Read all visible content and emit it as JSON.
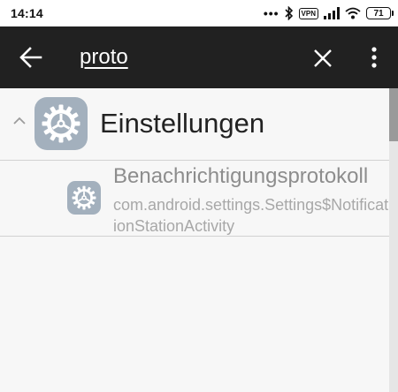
{
  "status_bar": {
    "time": "14:14",
    "dots": "•••",
    "vpn_label": "VPN",
    "battery_level": "71",
    "icons": [
      "bluetooth-icon",
      "signal-icon",
      "wifi-icon",
      "battery-icon"
    ]
  },
  "toolbar": {
    "back_icon": "arrow-back-icon",
    "search_query": "proto",
    "clear_icon": "close-icon",
    "more_icon": "more-vert-icon",
    "background": "#212121"
  },
  "results": {
    "group": {
      "app_name": "Einstellungen",
      "expanded": true,
      "icon": "settings-gear-icon",
      "icon_color": "#a3b0bd"
    },
    "items": [
      {
        "title": "Benachrichtigungsprotokoll",
        "activity": "com.android.settings.Settings$NotificationStationActivity",
        "icon": "settings-gear-icon"
      }
    ]
  }
}
